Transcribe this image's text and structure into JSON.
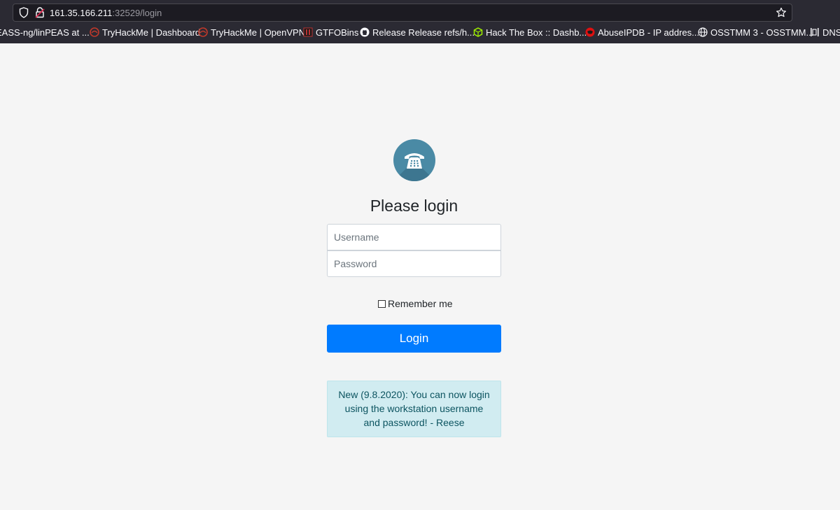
{
  "browser": {
    "url_host": "161.35.166.211",
    "url_path": ":32529/login",
    "bookmarks": [
      {
        "label": "EASS-ng/linPEAS at ...",
        "icon": "github-icon"
      },
      {
        "label": "TryHackMe | Dashboard",
        "icon": "tryhackme-icon"
      },
      {
        "label": "TryHackMe | OpenVPN",
        "icon": "tryhackme-icon"
      },
      {
        "label": "GTFOBins",
        "icon": "gtfobins-icon"
      },
      {
        "label": "Release Release refs/h...",
        "icon": "github-icon"
      },
      {
        "label": "Hack The Box :: Dashb...",
        "icon": "hackthebox-icon"
      },
      {
        "label": "AbuseIPDB - IP addres...",
        "icon": "abuseipdb-icon"
      },
      {
        "label": "OSSTMM 3 - OSSTMM...",
        "icon": "globe-icon"
      },
      {
        "label": "DNS",
        "icon": "dns-icon"
      }
    ]
  },
  "login": {
    "title": "Please login",
    "username_placeholder": "Username",
    "password_placeholder": "Password",
    "remember_label": "Remember me",
    "button_label": "Login",
    "notice": "New (9.8.2020): You can now login using the workstation username and password! - Reese"
  },
  "colors": {
    "primary": "#007bff",
    "logo": "#4a8aa5",
    "alert_bg": "#d1ecf1",
    "alert_text": "#0c5460"
  }
}
